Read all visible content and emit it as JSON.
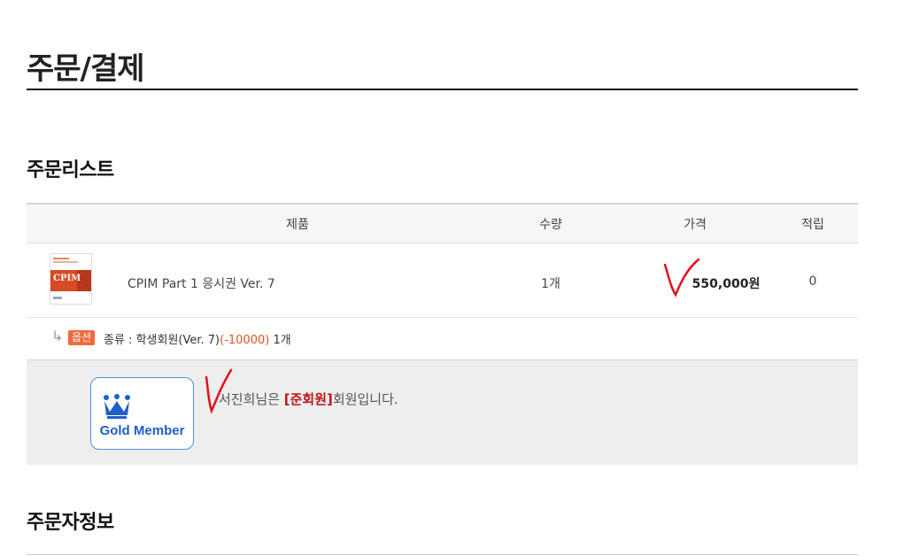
{
  "page_title": "주문/결제",
  "sections": {
    "order_list": "주문리스트",
    "orderer_info": "주문자정보"
  },
  "table": {
    "headers": [
      "제품",
      "수량",
      "가격",
      "적립"
    ],
    "item": {
      "thumb_brand": "CPIM",
      "name": "CPIM Part 1 응시권 Ver. 7",
      "qty": "1개",
      "price": "550,000원",
      "points": "0"
    },
    "option": {
      "badge": "옵션",
      "label": "종류 : 학생회원(Ver. 7)",
      "extra_price": "(-10000)",
      "qty": "1개"
    }
  },
  "member": {
    "badge_label": "Gold Member",
    "prefix": "서진희님은 ",
    "grade": "[준회원]",
    "suffix": "회원입니다."
  },
  "colors": {
    "accent_red": "#c0121a",
    "option_orange": "#ef6a3a",
    "badge_blue": "#1e5fc8",
    "annotation_red": "#e0101a"
  }
}
